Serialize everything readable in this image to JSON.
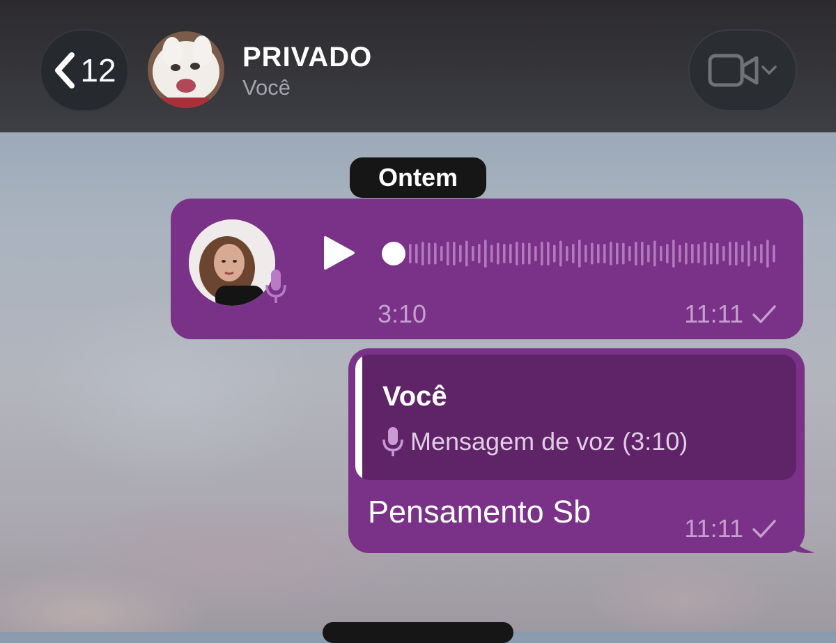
{
  "header": {
    "back_count": "12",
    "title": "PRIVADO",
    "subtitle": "Você",
    "icons": [
      "chevron-left-icon",
      "video-camera-icon",
      "chevron-down-icon"
    ]
  },
  "chat": {
    "date_label": "Ontem",
    "voice_message": {
      "duration": "3:10",
      "time": "11:11",
      "status": "sent"
    },
    "reply_message": {
      "quoted_author": "Você",
      "quoted_text": "Mensagem de voz (3:10)",
      "text": "Pensamento Sb",
      "time": "11:11",
      "status": "sent"
    }
  },
  "colors": {
    "bubble": "#7a3288",
    "quote_background": "#5f2368",
    "header": "#2c2a2e",
    "date_pill": "#161617"
  }
}
